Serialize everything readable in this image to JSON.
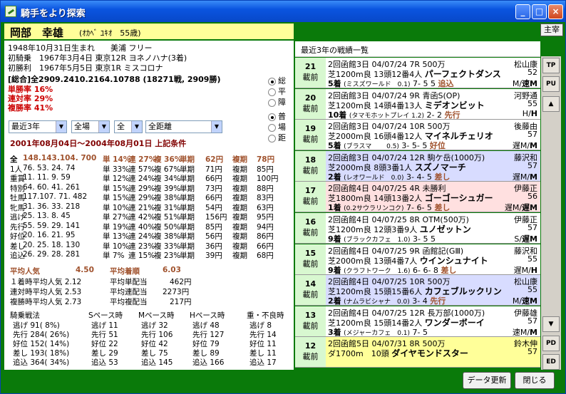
{
  "window": {
    "title": "騎手をより探索",
    "btn_min": "_",
    "btn_max": "□",
    "btn_close": "×",
    "main_btn": "主宰"
  },
  "jockey": {
    "name": "岡部　幸雄",
    "kana": "(ｵｶﾍﾞ ﾕｷｵ　55歳)",
    "birth": "1948年10月31日生まれ　　美浦 フリー",
    "first_ride": "初騎乗　1967年3月4日 東京12R ヨネノハナ(3着)",
    "first_win": "初勝利　1967年5月5日 東京1R ミスコロナ"
  },
  "summary": {
    "line": "[総合]全2909.2410.2164.10788 (18271戦, 2909勝)",
    "win_rate": "単勝率 16%",
    "place_rate": "連対率 29%",
    "show_rate": "複勝率 41%"
  },
  "radios1": [
    "総",
    "平",
    "障"
  ],
  "radios2": [
    "普",
    "場",
    "距"
  ],
  "filters": {
    "period": "最近3年",
    "course": "全場",
    "type": "全",
    "dist": "全距離"
  },
  "period_text": "2001年08月04日～2004年08月01日 上記条件",
  "stat_rows": [
    {
      "label": "全",
      "vals": "148.143.104. 700",
      "w": "単 14%",
      "r": "連 27%",
      "f": "複 36%",
      "tk": "単期",
      "tv": "62円",
      "fk": "複期",
      "fv": "78円",
      "hl": true
    },
    {
      "label": "1人",
      "vals": "76. 53. 24. 74",
      "w": "単 33%",
      "r": "連 57%",
      "f": "複 67%",
      "tk": "単期",
      "tv": "71円",
      "fk": "複期",
      "fv": "85円"
    },
    {
      "label": "重賞",
      "vals": "11. 11.  9. 59",
      "w": "単 12%",
      "r": "連 24%",
      "f": "複 34%",
      "tk": "単期",
      "tv": "66円",
      "fk": "複期",
      "fv": "100円"
    },
    {
      "label": "特別",
      "vals": "64. 60. 41. 261",
      "w": "単 15%",
      "r": "連 29%",
      "f": "複 39%",
      "tk": "単期",
      "tv": "73円",
      "fk": "複期",
      "fv": "88円"
    },
    {
      "label": "牡馬",
      "vals": "117.107. 71. 482",
      "w": "単 15%",
      "r": "連 29%",
      "f": "複 38%",
      "tk": "単期",
      "tv": "66円",
      "fk": "複期",
      "fv": "83円"
    },
    {
      "label": "牝馬",
      "vals": "31. 36. 33. 218",
      "w": "単 10%",
      "r": "連 21%",
      "f": "複 31%",
      "tk": "単期",
      "tv": "54円",
      "fk": "複期",
      "fv": "63円"
    },
    {
      "label": "逃げ",
      "vals": "25. 13.  8. 45",
      "w": "単 27%",
      "r": "連 42%",
      "f": "複 51%",
      "tk": "単期",
      "tv": "156円",
      "fk": "複期",
      "fv": "95円"
    },
    {
      "label": "先行",
      "vals": "55. 59. 29. 141",
      "w": "単 19%",
      "r": "連 40%",
      "f": "複 50%",
      "tk": "単期",
      "tv": "85円",
      "fk": "複期",
      "fv": "94円"
    },
    {
      "label": "好位",
      "vals": "20. 16. 21. 95",
      "w": "単 13%",
      "r": "連 24%",
      "f": "複 38%",
      "tk": "単期",
      "tv": "56円",
      "fk": "複期",
      "fv": "86円"
    },
    {
      "label": "差し",
      "vals": "20. 25. 18. 130",
      "w": "単 10%",
      "r": "連 23%",
      "f": "複 33%",
      "tk": "単期",
      "tv": "36円",
      "fk": "複期",
      "fv": "66円"
    },
    {
      "label": "追込",
      "vals": "26. 29. 28. 281",
      "w": "単  7%",
      "r": "連 15%",
      "f": "複 23%",
      "tk": "単期",
      "tv": "39円",
      "fk": "複期",
      "fv": "68円"
    }
  ],
  "avg": {
    "pop_label": "平均人気",
    "pop_val": "4.50",
    "rank_label": "平均着順",
    "rank_val": "6.03",
    "r1": "１着時平均人気 2.12",
    "r1b": "平均単配当",
    "r1v": "462円",
    "r2": "連対時平均人気 2.53",
    "r2b": "平均連配当",
    "r2v": "2273円",
    "r3": "複勝時平均人気 2.73",
    "r3b": "平均複配当",
    "r3v": "217円"
  },
  "pace": {
    "header": [
      "騎乗戦法",
      "Sペース時",
      "Mペース時",
      "Hペース時",
      "重・不良時"
    ],
    "rows": [
      [
        "逃げ  91( 8%)",
        "逃げ  11",
        "逃げ  32",
        "逃げ  48",
        "逃げ   8"
      ],
      [
        "先行 284( 26%)",
        "先行  51",
        "先行 106",
        "先行 127",
        "先行  14"
      ],
      [
        "好位 152( 14%)",
        "好位  22",
        "好位  42",
        "好位  79",
        "好位  11"
      ],
      [
        "差し 193( 18%)",
        "差し  29",
        "差し  75",
        "差し  89",
        "差し  11"
      ],
      [
        "追込 364( 34%)",
        "追込  53",
        "追込 145",
        "追込 166",
        "追込  17"
      ]
    ]
  },
  "right_title": "最近3年の戦績一覧",
  "races": [
    {
      "w": "21",
      "s": "載前",
      "bg": "#ffffff",
      "l1": "2回函館3日 04/07/24  7R 500万",
      "j": "松山康",
      "l2a": "芝1200m良 13頭12番4人",
      "horse": "パーフェクトダンス",
      "kg": "52",
      "l3a": "5着",
      "l3b": "(ミスズワールド　0.1)",
      "l3c": "7- 5 5",
      "st": "追込",
      "l3d": "M/",
      "l3e": "速M"
    },
    {
      "w": "20",
      "s": "載前",
      "bg": "#ffffff",
      "l1": "2回函館3日 04/07/24  9R 青函S(OP)",
      "j": "河野通",
      "l2a": "芝1200m良 14頭4番13人",
      "horse": "ミデオンビット",
      "kg": "55",
      "l3a": "10着",
      "l3b": "(タマモホットプレイ 1.2)",
      "l3c": "2- 2",
      "st": "先行",
      "l3d": "H/",
      "l3e": "H"
    },
    {
      "w": "19",
      "s": "載前",
      "bg": "#ffffff",
      "l1": "2回函館3日 04/07/24 10R 500万",
      "j": "後藤由",
      "l2a": "芝2000m良 16頭4番12人",
      "horse": "マイネルチェリオ",
      "kg": "57",
      "l3a": "5着",
      "l3b": "(ブラスマ　　 0.5)",
      "l3c": "3- 5- 5",
      "st": "好位",
      "l3d": "遅M/",
      "l3e": "M"
    },
    {
      "w": "18",
      "s": "載前",
      "bg": "#d8dcff",
      "l1": "2回函館3日 04/07/24 12R 駒ケ岳(1000万)",
      "j": "藤沢和",
      "l2a": "芝2000m良 8頭3番1人",
      "horse": "スズノマーチ",
      "kg": "57",
      "l3a": "2着",
      "l3b": "(レオワールド　0.0)",
      "l3c": "3- 4- 5",
      "st": "差し",
      "l3d": "遅M/",
      "l3e": "M"
    },
    {
      "w": "17",
      "s": "載前",
      "bg": "#ffe0e0",
      "l1": "2回函館4日 04/07/25  4R 未勝利",
      "j": "伊藤正",
      "l2a": "芝1800m良 14頭13番2人",
      "horse": "ゴーゴーシュガー",
      "kg": "56",
      "l3a": "1着",
      "l3b": "(0.2サウラリンコク)",
      "l3c": "7- 6- 5",
      "st": "差し",
      "l3d": "遅M/",
      "l3e": "遅M"
    },
    {
      "w": "16",
      "s": "載前",
      "bg": "#ffffff",
      "l1": "2回函館4日 04/07/25  8R OTM(500万)",
      "j": "伊藤正",
      "l2a": "芝1200m良 12頭3番9人",
      "horse": "ユノゼットン",
      "kg": "57",
      "l3a": "9着",
      "l3b": "(ブラックカフェ　1.0)",
      "l3c": "3- 5 5",
      "st": "",
      "l3d": "S/",
      "l3e": "遅M"
    },
    {
      "w": "15",
      "s": "載前",
      "bg": "#ffffff",
      "l1": "2回函館4日 04/07/25  9R 函館記(GⅢ)",
      "j": "藤沢和",
      "l2a": "芝2000m良 13頭4番7人",
      "horse": "ウインシュナイト",
      "kg": "55",
      "l3a": "9着",
      "l3b": "(クラフトワーク　1.6)",
      "l3c": "6- 6- 8",
      "st": "差し",
      "l3d": "遅M/",
      "l3e": "H"
    },
    {
      "w": "14",
      "s": "載前",
      "bg": "#d8dcff",
      "l1": "2回函館4日 04/07/25 10R 500万",
      "j": "松山康",
      "l2a": "芝1200m良 15頭15番6人",
      "horse": "カフェブルックリン",
      "kg": "55",
      "l3a": "2着",
      "l3b": "(ナムラビシャナ　0.0)",
      "l3c": "3- 4",
      "st": "先行",
      "l3d": "M/",
      "l3e": "速M"
    },
    {
      "w": "13",
      "s": "載前",
      "bg": "#ffffff",
      "l1": "2回函館4日 04/07/25 12R 長万部(1000万)",
      "j": "伊藤雄",
      "l2a": "芝1200m良 15頭14番2人",
      "horse": "ワンダーボーイ",
      "kg": "57",
      "l3a": "3着",
      "l3b": "(メジャーカフェ　0.1)",
      "l3c": "7- 5",
      "st": "",
      "l3d": "速M/",
      "l3e": "M"
    },
    {
      "w": "12",
      "s": "載前",
      "bg": "#ffff99",
      "l1": "2回函館5日 04/07/31  8R 500万",
      "j": "鈴木伸",
      "l2a": "ダ1700m　10頭",
      "horse": "ダイヤモンドスター",
      "kg": "57",
      "l3a": "",
      "l3b": "",
      "l3c": "",
      "st": "",
      "l3d": "",
      "l3e": ""
    }
  ],
  "side_buttons": [
    "TP",
    "PU",
    "▲",
    "▼",
    "PD",
    "ED"
  ],
  "bottom": {
    "update": "データ更新",
    "close": "閉じる"
  }
}
